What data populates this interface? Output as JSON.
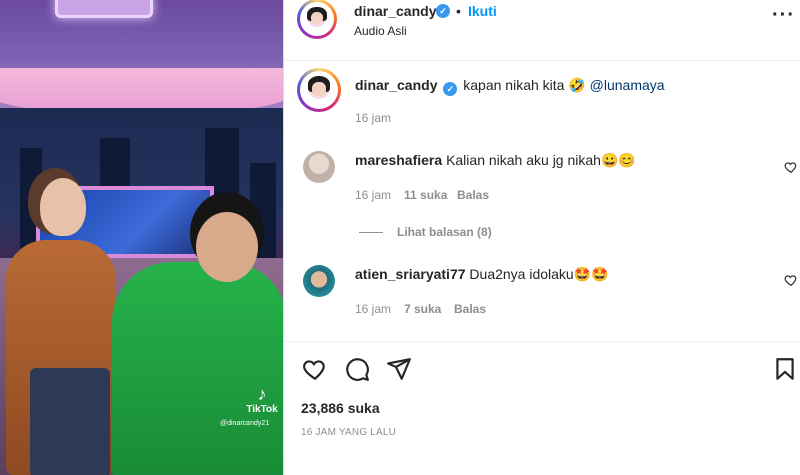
{
  "media": {
    "watermark_brand": "TikTok",
    "watermark_handle": "@dinarcandy21",
    "tiktok_icon": "music-note-icon"
  },
  "post": {
    "username": "dinar_candy",
    "separator": "•",
    "follow_label": "Ikuti",
    "audio_label": "Audio Asli",
    "more_icon": "more-horizontal-icon"
  },
  "caption": {
    "username": "dinar_candy",
    "text": "kapan nikah kita 🤣",
    "mention": "@lunamaya",
    "time": "16 jam"
  },
  "comments": [
    {
      "username": "mareshafiera",
      "text": "Kalian nikah aku jg nikah😀😊",
      "time": "16 jam",
      "likes": "11 suka",
      "reply_label": "Balas",
      "view_replies": "Lihat balasan (8)"
    },
    {
      "username": "atien_sriaryati77",
      "text": "Dua2nya idolaku🤩🤩",
      "time": "16 jam",
      "likes": "7 suka",
      "reply_label": "Balas"
    }
  ],
  "actions": {
    "likes_count": "23,886 suka",
    "posted_ago": "16 JAM YANG LALU"
  },
  "colors": {
    "link_blue": "#0095f6",
    "verified_blue": "#3897f0",
    "muted": "#8e8e8e",
    "text": "#262626"
  }
}
